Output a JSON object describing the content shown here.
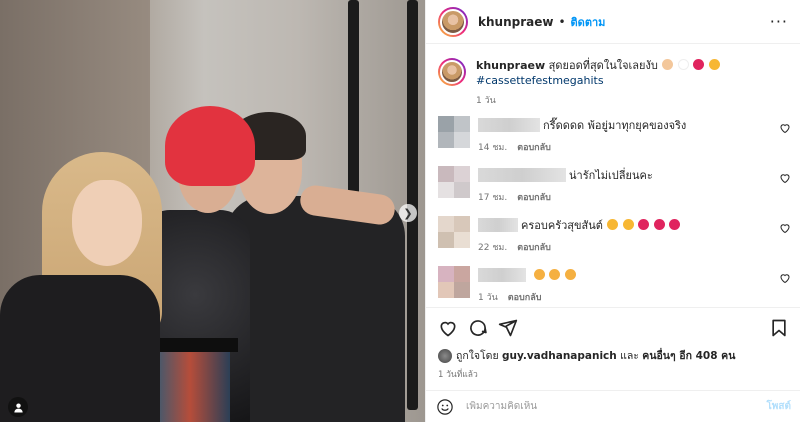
{
  "photo": {
    "next_icon": "chevron-right-icon",
    "tag_icon": "user-tag-icon"
  },
  "header": {
    "username": "khunpraew",
    "separator": "•",
    "follow_label": "ติดตาม",
    "more_icon": "more-horizontal-icon",
    "more_label": "···"
  },
  "caption": {
    "username": "khunpraew",
    "text": "สุดยอดที่สุดในใจเลยงับ",
    "hashtag": "#cassettefestmegahits",
    "time": "1 วัน"
  },
  "comments": [
    {
      "text": "กรี๊ดดดด พ้อยู่มาทุกยุคของจริง",
      "time": "14 ชม.",
      "reply": "ตอบกลับ"
    },
    {
      "text": "น่ารักไม่เปลี่ยนคะ",
      "time": "17 ชม.",
      "reply": "ตอบกลับ"
    },
    {
      "text": "ครอบครัวสุขสันต์",
      "time": "22 ชม.",
      "reply": "ตอบกลับ"
    },
    {
      "text": "",
      "time": "1 วัน",
      "reply": "ตอบกลับ"
    }
  ],
  "actions": {
    "like_icon": "heart-icon",
    "comment_icon": "comment-icon",
    "share_icon": "share-icon",
    "save_icon": "bookmark-icon"
  },
  "likes": {
    "prefix": "ถูกใจโดย",
    "user": "guy.vadhanapanich",
    "middle": "และ",
    "others": "คนอื่นๆ อีก 408 คน"
  },
  "posted_ago": "1 วันที่แล้ว",
  "add_comment": {
    "placeholder": "เพิ่มความคิดเห็น",
    "post_label": "โพสต์",
    "emoji_icon": "emoji-icon"
  },
  "colors": {
    "accent": "#0095f6",
    "hashtag": "#00376b",
    "muted": "#737373"
  }
}
